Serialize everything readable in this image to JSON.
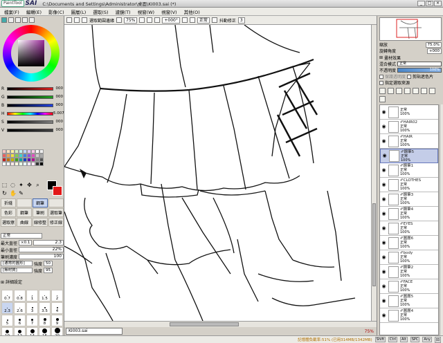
{
  "titlebar": {
    "logo_paint": "PaintTool",
    "logo_sai": "SAI",
    "window_title": "C:\\Documents and Settings\\Administrator\\桌面\\KI003.sai (*)",
    "btn_min": "_",
    "btn_max": "□",
    "btn_close": "×"
  },
  "menu": [
    "檔案(F)",
    "編輯(E)",
    "影像(C)",
    "圖層(L)",
    "選取(S)",
    "濾鏡(T)",
    "視窗(W)",
    "視窗(V)",
    "其他(O)"
  ],
  "toolbar": {
    "select_source_label": "選取範圍邊緣",
    "zoom": "75%",
    "rotation": "+000°",
    "blend": "正常",
    "stabilizer_label": "抖動修正",
    "stabilizer_value": "3"
  },
  "color_sliders": [
    {
      "label": "R",
      "value": "000",
      "color": "#e02020"
    },
    {
      "label": "G",
      "value": "000",
      "color": "#20a020"
    },
    {
      "label": "B",
      "value": "000",
      "color": "#2040e0"
    },
    {
      "label": "H",
      "value": "5.007",
      "color": "#a0a0ff"
    },
    {
      "label": "S",
      "value": "000",
      "color": "#808080"
    },
    {
      "label": "V",
      "value": "000",
      "color": "#404040"
    }
  ],
  "swatch_colors": [
    "#f4c4c4",
    "#f8e0c0",
    "#fff0a0",
    "#d8f0c0",
    "#c0f0f0",
    "#c0d8f8",
    "#e0c8f8",
    "#f8c8e8",
    "#ffffff",
    "#eeeeee",
    "#e86060",
    "#f0a050",
    "#f0e040",
    "#80d050",
    "#40d0d0",
    "#4080e0",
    "#9050e0",
    "#e050c0",
    "#cccccc",
    "#aaaaaa",
    "#c02020",
    "#c07010",
    "#c0b000",
    "#40a020",
    "#10a0a0",
    "#1040c0",
    "#6010b0",
    "#b01090",
    "#888888",
    "#555555",
    "#ffffff",
    "#f4f4f4",
    "#ffe8e8",
    "#ffffe0",
    "#e8ffe8",
    "#e8f8ff",
    "#f0e8ff",
    "#ffe8f8",
    "#333333",
    "#000000"
  ],
  "brush_tools": [
    {
      "label": "折綫",
      "sel": false
    },
    {
      "label": "",
      "sel": false
    },
    {
      "label": "鋼筆",
      "sel": true
    },
    {
      "label": "",
      "sel": false
    },
    {
      "label": "色彩",
      "sel": false
    },
    {
      "label": "鋼筆",
      "sel": false
    },
    {
      "label": "筆刷",
      "sel": false
    },
    {
      "label": "選取筆",
      "sel": false
    },
    {
      "label": "選取擦",
      "sel": false
    },
    {
      "label": "曲線",
      "sel": false
    },
    {
      "label": "線修整",
      "sel": false
    },
    {
      "label": "修正線",
      "sel": false
    }
  ],
  "tool_options": {
    "blend_mode": "正常",
    "max_size_label": "最大直徑",
    "max_size_mult": "×0.1",
    "max_size_value": "2.3",
    "min_size_label": "最小直徑",
    "min_size_value": "22%",
    "density_label": "筆刷濃度",
    "density_value": "100",
    "texture_label": "[通常的圓形]",
    "texture_value": "強度",
    "texture_num": "50",
    "paper_label": "[無材質]",
    "paper_value": "強度",
    "paper_num": "95"
  },
  "detail_label": "詳細設定",
  "brush_sizes": [
    {
      "label": "0.7",
      "d": 0,
      "sel": false
    },
    {
      "label": "0.8",
      "d": 0,
      "sel": false
    },
    {
      "label": "1",
      "d": 0,
      "sel": false
    },
    {
      "label": "1.5",
      "d": 1,
      "sel": false
    },
    {
      "label": "2",
      "d": 1,
      "sel": false
    },
    {
      "label": "2.3",
      "d": 1,
      "sel": true
    },
    {
      "label": "2.6",
      "d": 1,
      "sel": false
    },
    {
      "label": "3",
      "d": 2,
      "sel": false
    },
    {
      "label": "3.5",
      "d": 2,
      "sel": false
    },
    {
      "label": "4",
      "d": 2,
      "sel": false
    },
    {
      "label": "5",
      "d": 2,
      "sel": false
    },
    {
      "label": "6",
      "d": 3,
      "sel": false
    },
    {
      "label": "7",
      "d": 3,
      "sel": false
    },
    {
      "label": "8",
      "d": 4,
      "sel": false
    },
    {
      "label": "9",
      "d": 4,
      "sel": false
    },
    {
      "label": "10",
      "d": 5,
      "sel": false
    },
    {
      "label": "12",
      "d": 5,
      "sel": false
    },
    {
      "label": "14",
      "d": 6,
      "sel": false
    },
    {
      "label": "16",
      "d": 7,
      "sel": false
    },
    {
      "label": "20",
      "d": 8,
      "sel": false
    },
    {
      "label": "25",
      "d": 9,
      "sel": false
    },
    {
      "label": "30",
      "d": 10,
      "sel": false
    }
  ],
  "document": {
    "tab_name": "KI003.sai",
    "tab_zoom": "75%"
  },
  "navigator": {
    "zoom_label": "縮放",
    "zoom_value": "75.0%",
    "rotate_label": "旋轉角度",
    "rotate_value": "+000"
  },
  "layer_panel": {
    "effects_label": "畫材效果",
    "blend_label": "混合模式",
    "blend_value": "正常",
    "opacity_label": "不透明度",
    "opacity_value": "100%",
    "opacity_level": 1.0,
    "preserve_label": "保護透明度",
    "clip_label": "剪貼遮色片",
    "select_source_label": "指定選取來源"
  },
  "layers": [
    {
      "name": "",
      "mode": "正常",
      "op": "100%",
      "sel": false
    },
    {
      "name": "HAIR02",
      "mode": "正常",
      "op": "100%",
      "sel": false
    },
    {
      "name": "HAIR",
      "mode": "正常",
      "op": "100%",
      "sel": false
    },
    {
      "name": "鋼筆5",
      "mode": "正常",
      "op": "100%",
      "sel": true
    },
    {
      "name": "鋼筆1",
      "mode": "正常",
      "op": "100%",
      "sel": false
    },
    {
      "name": "CLOTHES",
      "mode": "正常",
      "op": "100%",
      "sel": false
    },
    {
      "name": "鋼筆3",
      "mode": "正常",
      "op": "100%",
      "sel": false
    },
    {
      "name": "鋼筆4",
      "mode": "正常",
      "op": "100%",
      "sel": false
    },
    {
      "name": "EYES",
      "mode": "正常",
      "op": "100%",
      "sel": false
    },
    {
      "name": "圖層6",
      "mode": "正常",
      "op": "100%",
      "sel": false
    },
    {
      "name": "body",
      "mode": "正常",
      "op": "100%",
      "sel": false
    },
    {
      "name": "鋼筆2",
      "mode": "正常",
      "op": "100%",
      "sel": false
    },
    {
      "name": "FACE",
      "mode": "正常",
      "op": "100%",
      "sel": false
    },
    {
      "name": "圖層5",
      "mode": "正常",
      "op": "100%",
      "sel": false
    },
    {
      "name": "圖層4",
      "mode": "正常",
      "op": "100%",
      "sel": false
    }
  ],
  "status": {
    "memory": "記憶體負載率:51%  (已用314MB/1342MB)",
    "indicators": [
      "Shift",
      "Ctrl",
      "Alt",
      "SPC",
      "Any",
      "凹"
    ]
  }
}
